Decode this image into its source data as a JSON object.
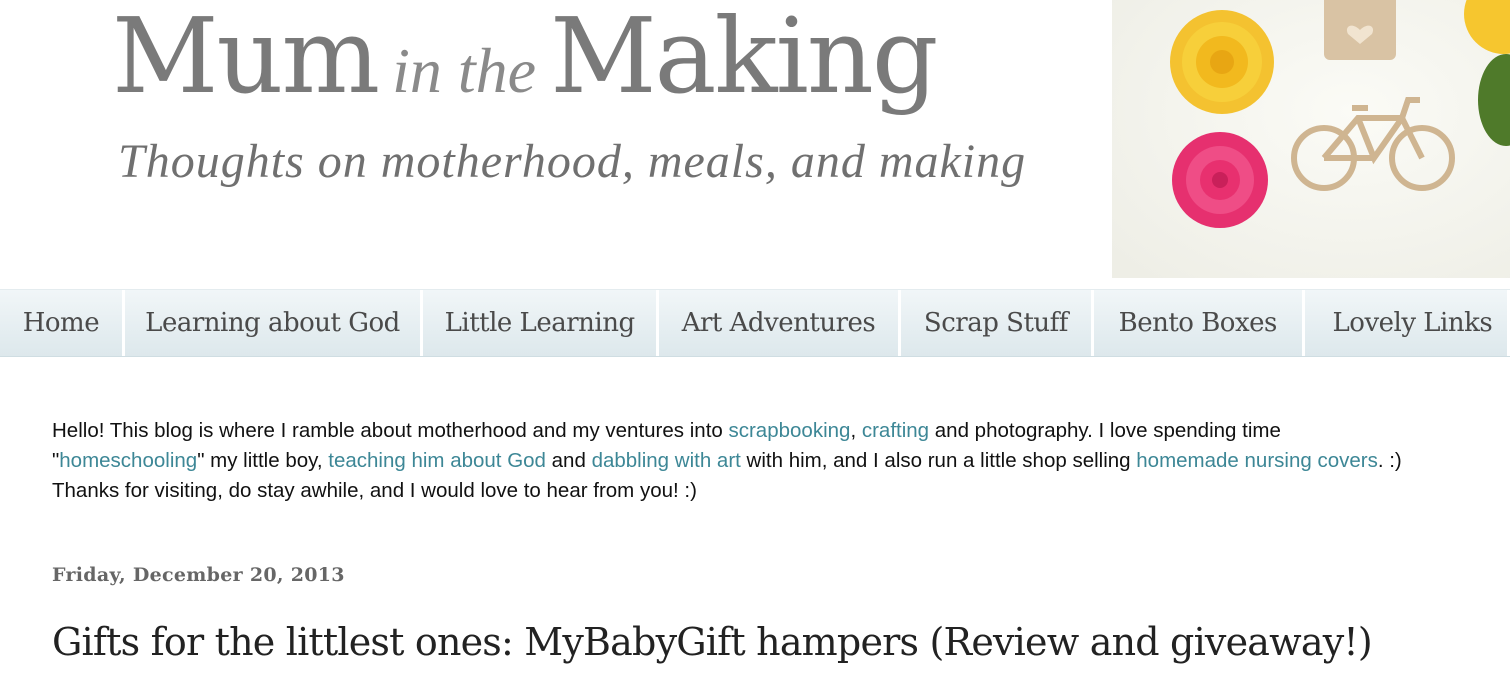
{
  "header": {
    "title_part1": "Mum",
    "title_part2": "in the",
    "title_part3": "Making",
    "tagline": "Thoughts on motherhood, meals, and making"
  },
  "nav": {
    "items": [
      {
        "label": "Home"
      },
      {
        "label": "Learning about God"
      },
      {
        "label": "Little Learning"
      },
      {
        "label": "Art Adventures"
      },
      {
        "label": "Scrap Stuff"
      },
      {
        "label": "Bento Boxes"
      },
      {
        "label": "Lovely Links"
      }
    ]
  },
  "intro": {
    "t1": "Hello! This blog is where I ramble about motherhood and my ventures into ",
    "l1": "scrapbooking",
    "t2": ", ",
    "l2": "crafting",
    "t3": " and photography. I love spending time \"",
    "l3": "homeschooling",
    "t4": "\" my little boy, ",
    "l4": "teaching him about God",
    "t5": " and ",
    "l5": "dabbling with art",
    "t6": " with him, and I also run a little shop selling ",
    "l6": "homemade nursing covers",
    "t7": ". :) Thanks for visiting, do stay awhile, and I would love to hear from you! :)"
  },
  "post": {
    "date": "Friday, December 20, 2013",
    "title": "Gifts for the littlest ones: MyBabyGift hampers (Review and giveaway!)"
  },
  "colors": {
    "link": "#3d8796",
    "nav_bg": "#e6eef1",
    "title_gray": "#7a7a7a"
  }
}
